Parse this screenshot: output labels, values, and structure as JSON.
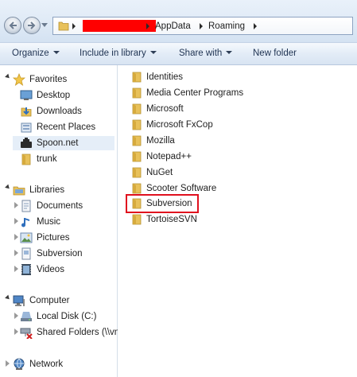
{
  "address": {
    "crumbs": [
      "AppData",
      "Roaming"
    ]
  },
  "toolbar": {
    "organize": "Organize",
    "include_in_library": "Include in library",
    "share_with": "Share with",
    "new_folder": "New folder"
  },
  "nav": {
    "favorites": {
      "label": "Favorites",
      "items": [
        "Desktop",
        "Downloads",
        "Recent Places",
        "Spoon.net",
        "trunk"
      ]
    },
    "libraries": {
      "label": "Libraries",
      "items": [
        "Documents",
        "Music",
        "Pictures",
        "Subversion",
        "Videos"
      ]
    },
    "computer": {
      "label": "Computer",
      "items": [
        "Local Disk (C:)",
        "Shared Folders (\\\\vn"
      ]
    },
    "network": {
      "label": "Network"
    }
  },
  "folders": [
    "Identities",
    "Media Center Programs",
    "Microsoft",
    "Microsoft FxCop",
    "Mozilla",
    "Notepad++",
    "NuGet",
    "Scooter Software",
    "Subversion",
    "TortoiseSVN"
  ],
  "colors": {
    "highlight_box": "#e0101e",
    "redaction": "#ff0000",
    "folder": "#e8c15a"
  }
}
